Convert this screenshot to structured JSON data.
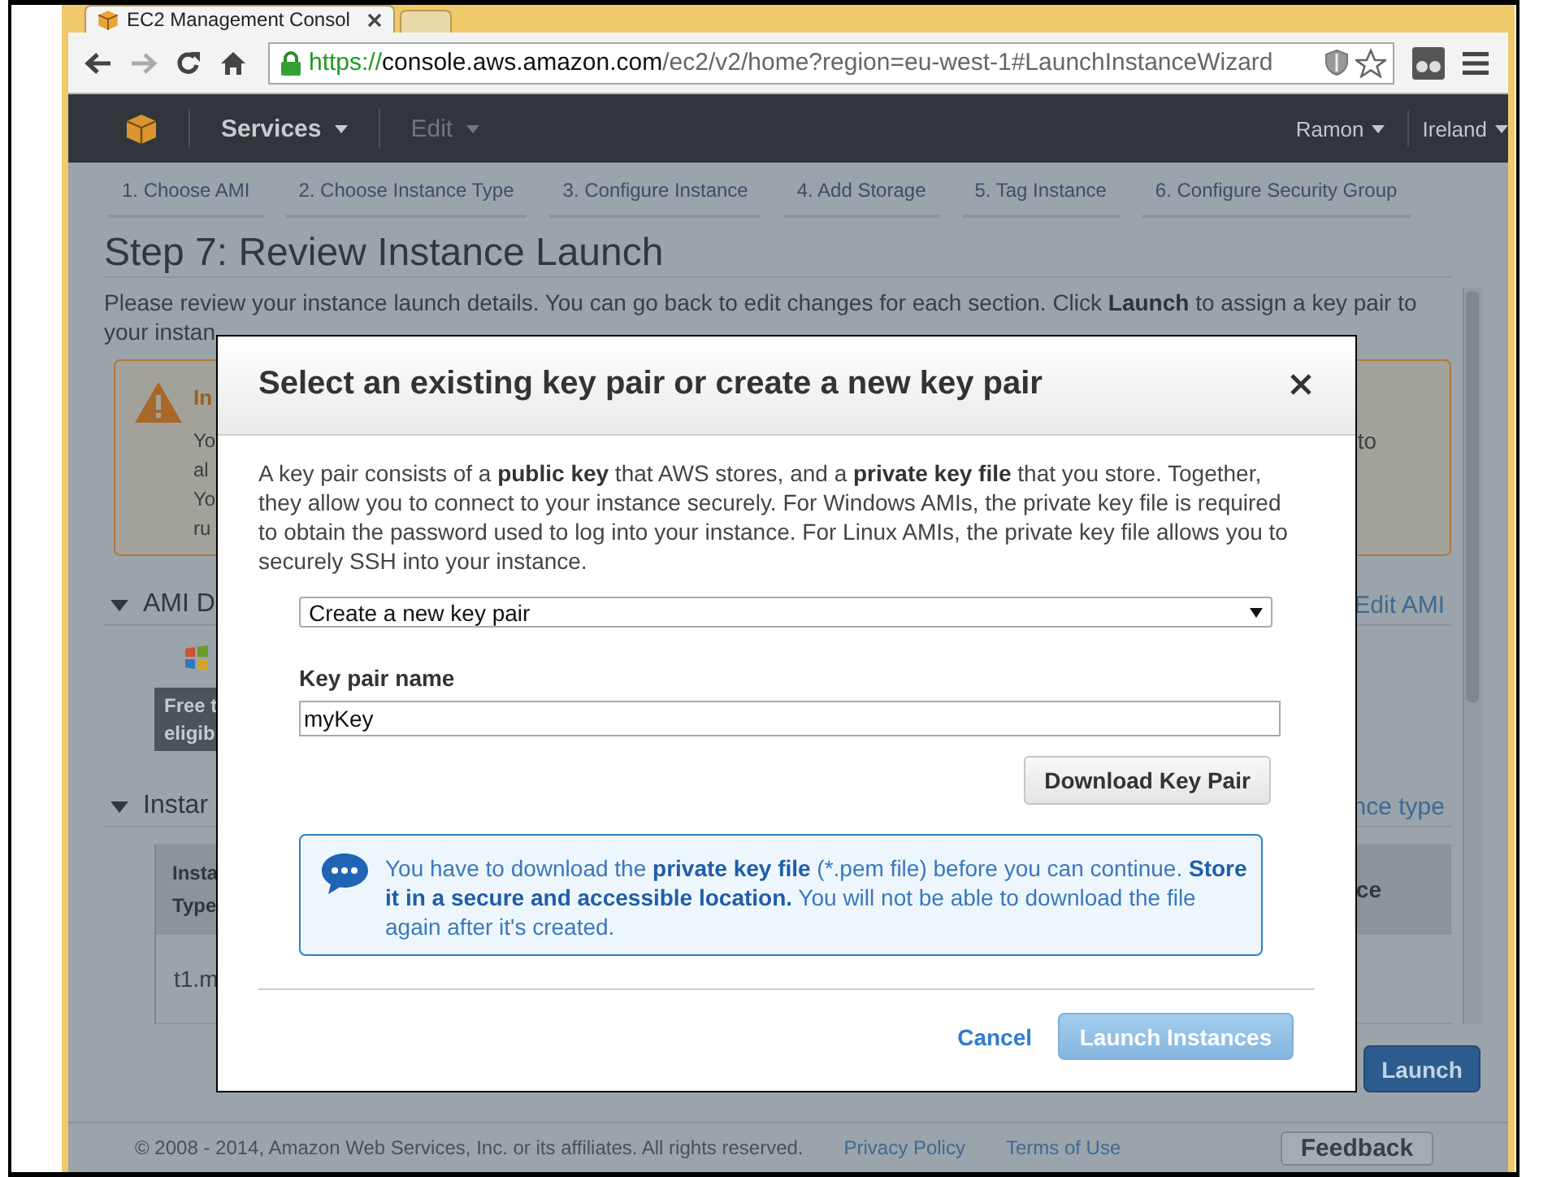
{
  "browser": {
    "tabs": [
      {
        "title": "EC2 Management Consol",
        "selected": true
      },
      {
        "selected": false
      }
    ],
    "address": {
      "secure": true,
      "scheme": "https://",
      "host": "console.aws.amazon.com",
      "path": "/ec2/v2/home?region=eu-west-1#LaunchInstanceWizard"
    }
  },
  "navbar": {
    "menus": [
      {
        "label": "Services",
        "disabled": false
      },
      {
        "label": "Edit",
        "disabled": true
      }
    ],
    "account": "Ramon",
    "region": "Ireland"
  },
  "wizard": {
    "steps": [
      {
        "label": "1. Choose AMI"
      },
      {
        "label": "2. Choose Instance Type"
      },
      {
        "label": "3. Configure Instance"
      },
      {
        "label": "4. Add Storage"
      },
      {
        "label": "5. Tag Instance"
      },
      {
        "label": "6. Configure Security Group"
      }
    ]
  },
  "page": {
    "title": "Step 7: Review Instance Launch",
    "intro": [
      "Please review your instance launch details. You can go back to edit changes for each section. Click **Launch** to assign a key pair to",
      "your instan"
    ],
    "warning": {
      "title": "In",
      "lines": [
        "Yo",
        "al",
        "Yo",
        "ru"
      ],
      "right_lines": [
        "to"
      ]
    },
    "sections": [
      {
        "kind": "ami",
        "title": "AMI D",
        "link": "Edit AMI",
        "expanded": true,
        "badge": [
          "Free t",
          "eligib"
        ]
      },
      {
        "kind": "table",
        "title": "Instar",
        "link": "nce type",
        "expanded": true,
        "table": {
          "columns": [
            "Insta Type",
            "ce"
          ],
          "rows": [
            [
              "t1.m"
            ]
          ]
        }
      }
    ],
    "launch_button": "Launch",
    "footer": {
      "copyright": "© 2008 - 2014, Amazon Web Services, Inc. or its affiliates. All rights reserved.",
      "links": [
        "Privacy Policy",
        "Terms of Use"
      ],
      "feedback": "Feedback"
    }
  },
  "modal": {
    "title": "Select an existing key pair or create a new key pair",
    "description": "A key pair consists of a **public key** that AWS stores, and a **private key file** that you store. Together, they allow you to connect to your instance securely. For Windows AMIs, the private key file is required to obtain the password used to log into your instance. For Linux AMIs, the private key file allows you to securely SSH into your instance.",
    "key_pair_option": "Create a new key pair",
    "name_label": "Key pair name",
    "name_value": "myKey",
    "download_button": "Download Key Pair",
    "info": "You have to download the **private key file** (*.pem file) before you can continue. **Store it in a secure and accessible location.** You will not be able to download the file again after it's created.",
    "cancel": "Cancel",
    "launch": {
      "label": "Launch Instances",
      "disabled": true
    }
  }
}
